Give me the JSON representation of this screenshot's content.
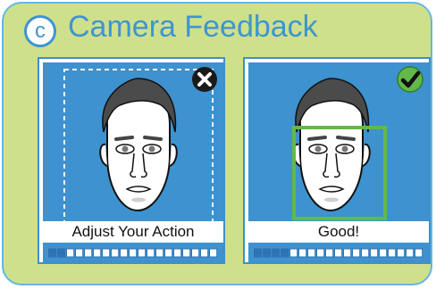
{
  "header": {
    "badge_letter": "c",
    "title": "Camera Feedback"
  },
  "panels": [
    {
      "caption": "Adjust Your Action",
      "status_icon": "close-icon",
      "filled_segments": 2,
      "total_segments": 19
    },
    {
      "caption": "Good!",
      "status_icon": "checkmark-icon",
      "filled_segments": 4,
      "total_segments": 19
    }
  ],
  "colors": {
    "card_bg": "#cfe08c",
    "accent_blue": "#3e95cf",
    "panel_bg": "#3d92cf",
    "success_green": "#64b84a",
    "progress_fill": "#2f73b5"
  }
}
